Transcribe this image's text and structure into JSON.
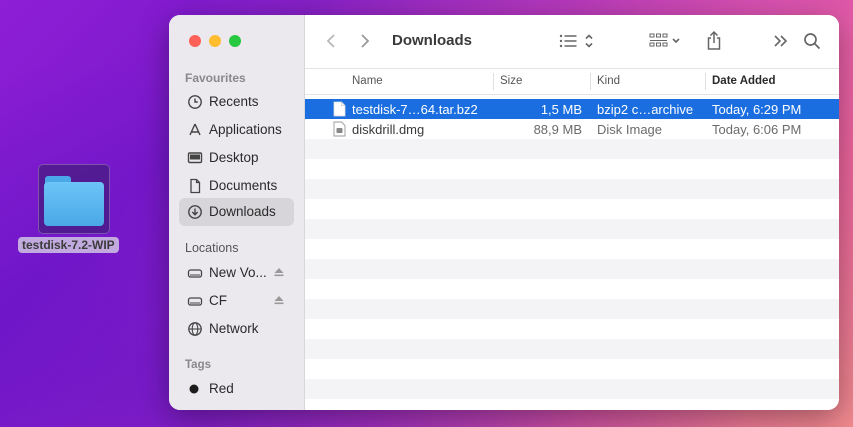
{
  "desktop": {
    "folder_label": "testdisk-7.2-WIP"
  },
  "window": {
    "title": "Downloads",
    "sidebar": {
      "favourites_title": "Favourites",
      "favourites": [
        {
          "label": "Recents",
          "icon": "clock-icon"
        },
        {
          "label": "Applications",
          "icon": "applications-icon"
        },
        {
          "label": "Desktop",
          "icon": "desktop-icon"
        },
        {
          "label": "Documents",
          "icon": "document-icon"
        },
        {
          "label": "Downloads",
          "icon": "download-icon",
          "selected": true
        }
      ],
      "locations_title": "Locations",
      "locations": [
        {
          "label": "New Vo...",
          "icon": "drive-icon",
          "ejectable": true
        },
        {
          "label": "CF",
          "icon": "drive-icon",
          "ejectable": true
        },
        {
          "label": "Network",
          "icon": "network-icon"
        }
      ],
      "tags_title": "Tags",
      "tags": [
        {
          "label": "Red",
          "color": "#1c1c1c"
        }
      ]
    },
    "columns": {
      "name": "Name",
      "size": "Size",
      "kind": "Kind",
      "date": "Date Added"
    },
    "files": [
      {
        "name": "testdisk-7…64.tar.bz2",
        "size": "1,5 MB",
        "kind": "bzip2 c…archive",
        "date": "Today, 6:29 PM",
        "selected": true
      },
      {
        "name": "diskdrill.dmg",
        "size": "88,9 MB",
        "kind": "Disk Image",
        "date": "Today, 6:06 PM",
        "selected": false
      }
    ],
    "colors": {
      "selection": "#1a6ee0",
      "sidebar_bg": "#ebe9ee"
    }
  }
}
